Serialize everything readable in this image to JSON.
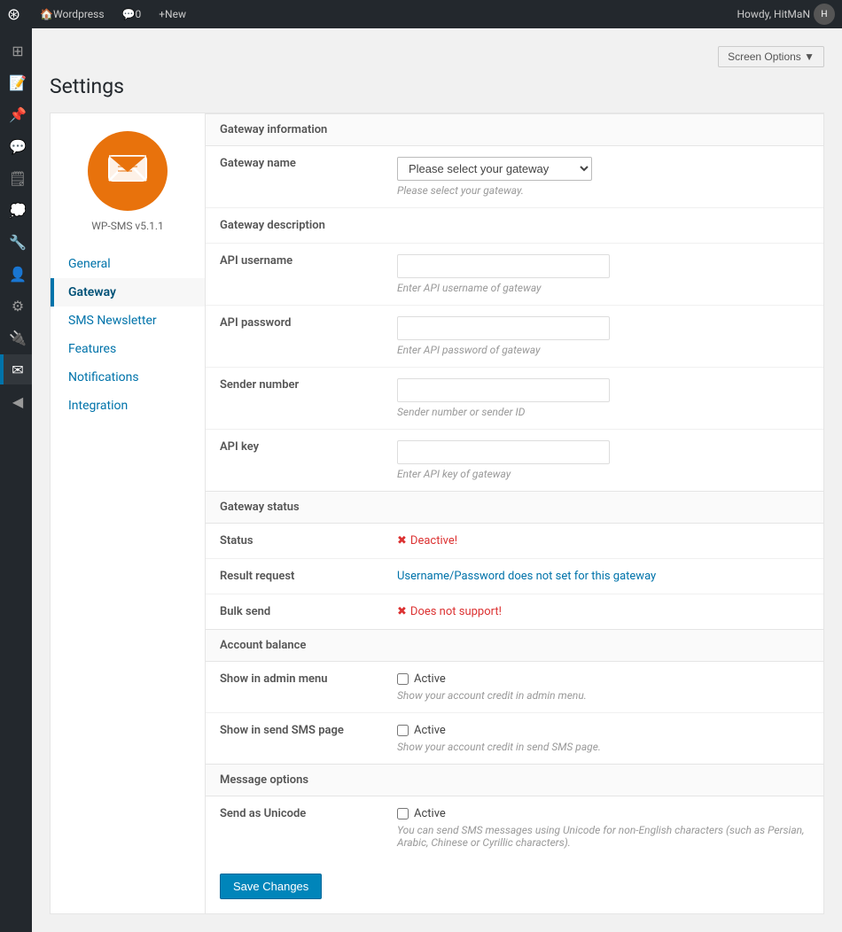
{
  "adminbar": {
    "logo": "⚙",
    "items": [
      {
        "label": "Wordpress",
        "icon": "🏠"
      },
      {
        "label": "0",
        "icon": "💬"
      },
      {
        "label": "New",
        "icon": "+"
      }
    ],
    "user": "Howdy, HitMaN",
    "screen_options": "Screen Options ▼"
  },
  "page_title": "Settings",
  "plugin": {
    "version": "WP-SMS v5.1.1",
    "nav": [
      {
        "id": "general",
        "label": "General"
      },
      {
        "id": "gateway",
        "label": "Gateway",
        "active": true
      },
      {
        "id": "sms-newsletter",
        "label": "SMS Newsletter"
      },
      {
        "id": "features",
        "label": "Features"
      },
      {
        "id": "notifications",
        "label": "Notifications"
      },
      {
        "id": "integration",
        "label": "Integration"
      }
    ]
  },
  "sections": {
    "gateway_info": {
      "title": "Gateway information",
      "fields": {
        "gateway_name": {
          "label": "Gateway name",
          "placeholder": "Please select your gateway",
          "desc": "Please select your gateway."
        },
        "gateway_desc": {
          "label": "Gateway description"
        },
        "api_username": {
          "label": "API username",
          "desc": "Enter API username of gateway"
        },
        "api_password": {
          "label": "API password",
          "desc": "Enter API password of gateway"
        },
        "sender_number": {
          "label": "Sender number",
          "desc": "Sender number or sender ID"
        },
        "api_key": {
          "label": "API key",
          "desc": "Enter API key of gateway"
        }
      }
    },
    "gateway_status": {
      "title": "Gateway status",
      "fields": {
        "status": {
          "label": "Status",
          "value": "Deactive!",
          "type": "error"
        },
        "result_request": {
          "label": "Result request",
          "value": "Username/Password does not set for this gateway",
          "type": "info"
        },
        "bulk_send": {
          "label": "Bulk send",
          "value": "Does not support!",
          "type": "error"
        }
      }
    },
    "account_balance": {
      "title": "Account balance",
      "fields": {
        "show_in_admin": {
          "label": "Show in admin menu",
          "checkbox_label": "Active",
          "desc": "Show your account credit in admin menu."
        },
        "show_in_sms": {
          "label": "Show in send SMS page",
          "checkbox_label": "Active",
          "desc": "Show your account credit in send SMS page."
        }
      }
    },
    "message_options": {
      "title": "Message options",
      "fields": {
        "send_as_unicode": {
          "label": "Send as Unicode",
          "checkbox_label": "Active",
          "desc": "You can send SMS messages using Unicode for non-English characters (such as Persian, Arabic, Chinese or Cyrillic characters)."
        }
      }
    }
  },
  "save_button": "Save Changes"
}
